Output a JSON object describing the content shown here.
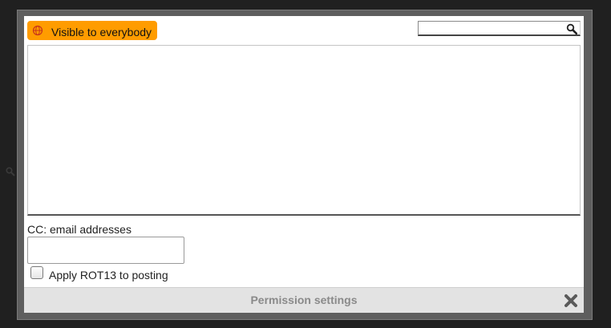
{
  "dialog": {
    "title": "Permission settings",
    "visibility": {
      "label": "Visible to everybody",
      "icon": "globe-icon",
      "color": "#ff9c00"
    },
    "search": {
      "value": "",
      "placeholder": "",
      "icon": "search-icon"
    },
    "cc": {
      "label": "CC: email addresses",
      "value": ""
    },
    "rot13": {
      "label": "Apply ROT13 to posting",
      "checked": false
    },
    "close_icon": "close-icon"
  },
  "colors": {
    "backdrop": "#202020",
    "frame": "#5e5e5e",
    "footer": "#e3e3e3",
    "accent": "#ff9c00"
  }
}
